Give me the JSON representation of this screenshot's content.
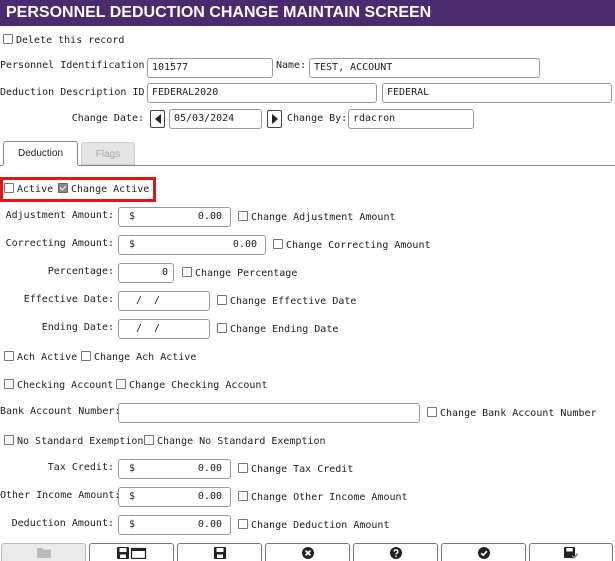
{
  "title": "PERSONNEL DEDUCTION CHANGE MAINTAIN SCREEN",
  "delete_record": {
    "label": "Delete this record",
    "checked": false
  },
  "personnel_id": {
    "label": "Personnel Identification:",
    "value": "101577"
  },
  "name": {
    "label": "Name:",
    "value": "TEST, ACCOUNT"
  },
  "deduction_desc": {
    "label": "Deduction Description ID:",
    "id_value": "FEDERAL2020",
    "desc_value": "FEDERAL"
  },
  "change_date": {
    "label": "Change Date:",
    "value": "05/03/2024"
  },
  "change_by": {
    "label": "Change By:",
    "value": "rdacron"
  },
  "tabs": [
    {
      "label": "Deduction",
      "active": true
    },
    {
      "label": "Flags",
      "active": false
    }
  ],
  "active": {
    "label": "Active",
    "checked": false
  },
  "change_active": {
    "label": "Change Active",
    "checked": true
  },
  "adjustment_amount": {
    "label": "Adjustment Amount:",
    "currency": "$",
    "value": "0.00",
    "change_label": "Change Adjustment Amount"
  },
  "correcting_amount": {
    "label": "Correcting Amount:",
    "currency": "$",
    "value": "0.00",
    "change_label": "Change Correcting Amount"
  },
  "percentage": {
    "label": "Percentage:",
    "value": "0",
    "change_label": "Change Percentage"
  },
  "effective_date": {
    "label": "Effective Date:",
    "value": "/  /",
    "change_label": "Change Effective Date"
  },
  "ending_date": {
    "label": "Ending Date:",
    "value": "/  /",
    "change_label": "Change Ending Date"
  },
  "ach_active": {
    "label": "Ach Active",
    "change_label": "Change Ach Active"
  },
  "checking_account": {
    "label": "Checking Account",
    "change_label": "Change Checking Account"
  },
  "bank_account_number": {
    "label": "Bank Account Number:",
    "value": "",
    "change_label": "Change Bank Account Number"
  },
  "no_standard_exemption": {
    "label": "No Standard Exemption",
    "change_label": "Change No Standard Exemption"
  },
  "tax_credit": {
    "label": "Tax Credit:",
    "currency": "$",
    "value": "0.00",
    "change_label": "Change Tax Credit"
  },
  "other_income_amount": {
    "label": "Other Income Amount:",
    "currency": "$",
    "value": "0.00",
    "change_label": "Change Other Income Amount"
  },
  "deduction_amount": {
    "label": "Deduction Amount:",
    "currency": "$",
    "value": "0.00",
    "change_label": "Change Deduction Amount"
  },
  "toolbar": [
    {
      "icon": "folder-icon",
      "enabled": false
    },
    {
      "icon": "save-new-icon",
      "enabled": true
    },
    {
      "icon": "save-icon",
      "enabled": true
    },
    {
      "icon": "cancel-icon",
      "enabled": true
    },
    {
      "icon": "help-icon",
      "enabled": true
    },
    {
      "icon": "ok-icon",
      "enabled": true
    },
    {
      "icon": "save-close-icon",
      "enabled": true
    }
  ],
  "colors": {
    "title_bar": "#4b2a6e",
    "highlight": "#e01515"
  }
}
